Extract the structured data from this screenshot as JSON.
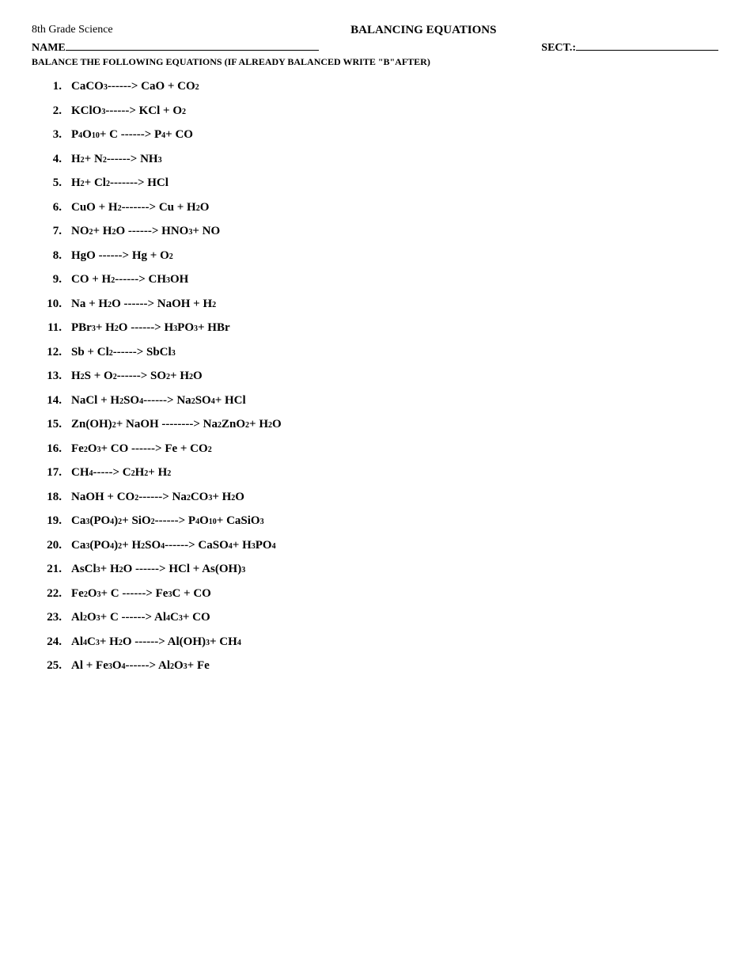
{
  "header": {
    "subject": "8th Grade Science",
    "title": "BALANCING EQUATIONS",
    "name_label": "NAME",
    "sect_label": "SECT.:",
    "instructions": "BALANCE THE FOLLOWING EQUATIONS (IF ALREADY BALANCED WRITE \"B\"AFTER)"
  },
  "equations": [
    {
      "num": "1.",
      "html": "CaCO<sub>3</sub> ------&gt; CaO + CO<sub>2</sub>"
    },
    {
      "num": "2.",
      "html": "KClO<sub>3</sub> ------&gt; KCl + O<sub>2</sub>"
    },
    {
      "num": "3.",
      "html": "P<sub>4</sub>O<sub>10</sub> + C ------&gt; P<sub>4</sub> + CO"
    },
    {
      "num": "4.",
      "html": "H<sub>2</sub> + N<sub>2</sub> ------&gt; NH<sub>3</sub>"
    },
    {
      "num": "5.",
      "html": "H<sub>2</sub> + Cl<sub>2</sub> -------&gt; HCl"
    },
    {
      "num": "6.",
      "html": "CuO + H<sub>2</sub> -------&gt; Cu + H<sub>2</sub>O"
    },
    {
      "num": "7.",
      "html": "NO<sub>2</sub> + H<sub>2</sub>O ------&gt; HNO<sub>3</sub> + NO"
    },
    {
      "num": "8.",
      "html": "HgO ------&gt; Hg + O<sub>2</sub>"
    },
    {
      "num": "9.",
      "html": "CO + H<sub>2</sub> ------&gt; CH<sub>3</sub>OH"
    },
    {
      "num": "10.",
      "html": "Na + H<sub>2</sub>O ------&gt; NaOH + H<sub>2</sub>"
    },
    {
      "num": "11.",
      "html": "PBr<sub>3</sub> + H<sub>2</sub>O ------&gt; H<sub>3</sub>PO<sub>3</sub> + HBr"
    },
    {
      "num": "12.",
      "html": "Sb + Cl<sub>2</sub> ------&gt; SbCl<sub>3</sub>"
    },
    {
      "num": "13.",
      "html": "H<sub>2</sub>S + O<sub>2</sub> ------&gt; SO<sub>2</sub> + H<sub>2</sub>O"
    },
    {
      "num": "14.",
      "html": "NaCl + H<sub>2</sub>SO<sub>4</sub> ------&gt; Na<sub>2</sub>SO<sub>4</sub> + HCl"
    },
    {
      "num": "15.",
      "html": "Zn(OH)<sub>2</sub> + NaOH --------&gt; Na<sub>2</sub>ZnO<sub>2</sub> + H<sub>2</sub>O"
    },
    {
      "num": "16.",
      "html": "Fe<sub>2</sub>O<sub>3</sub> + CO ------&gt; Fe + CO<sub>2</sub>"
    },
    {
      "num": "17.",
      "html": "CH<sub>4</sub> -----&gt; C<sub>2</sub>H<sub>2</sub> + H<sub>2</sub>"
    },
    {
      "num": "18.",
      "html": "NaOH + CO<sub>2</sub> ------&gt; Na<sub>2</sub>CO<sub>3</sub> + H<sub>2</sub>O"
    },
    {
      "num": "19.",
      "html": "Ca<sub>3</sub>(PO<sub>4</sub>)<sub>2</sub> + SiO<sub>2</sub> ------&gt; P<sub>4</sub>O<sub>10</sub> + CaSiO<sub>3</sub>"
    },
    {
      "num": "20.",
      "html": "Ca<sub>3</sub>(PO<sub>4</sub>)<sub>2</sub> + H<sub>2</sub>SO<sub>4</sub> ------&gt; CaSO<sub>4</sub> + H<sub>3</sub>PO<sub>4</sub>"
    },
    {
      "num": "21.",
      "html": "AsCl<sub>3</sub> + H<sub>2</sub>O ------&gt; HCl + As(OH)<sub>3</sub>"
    },
    {
      "num": "22.",
      "html": "Fe<sub>2</sub>O<sub>3</sub> + C ------&gt; Fe<sub>3</sub>C + CO"
    },
    {
      "num": "23.",
      "html": "Al<sub>2</sub>O<sub>3</sub> + C ------&gt; Al<sub>4</sub>C<sub>3</sub> + CO"
    },
    {
      "num": "24.",
      "html": "Al<sub>4</sub>C<sub>3</sub> + H<sub>2</sub>O ------&gt; Al(OH)<sub>3</sub> + CH<sub>4</sub>"
    },
    {
      "num": "25.",
      "html": "Al + Fe<sub>3</sub>O<sub>4</sub> ------&gt; Al<sub>2</sub>O<sub>3</sub> + Fe"
    }
  ]
}
